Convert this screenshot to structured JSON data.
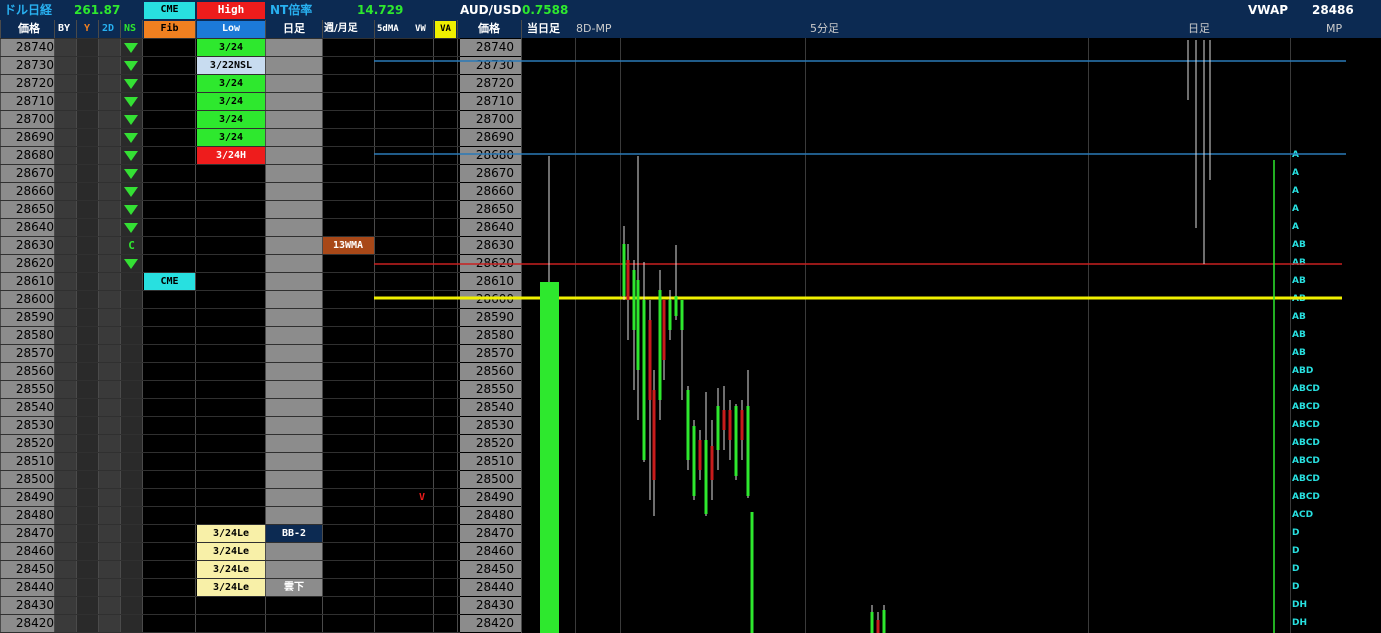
{
  "header": {
    "nikkei_label": "ドル日経",
    "nikkei_value": "261.87",
    "cme": "CME",
    "high": "High",
    "nt_label": "NT倍率",
    "nt_value": "14.729",
    "aud_label": "AUD/USD",
    "aud_value": "0.7588",
    "vwap_label": "VWAP",
    "vwap_value": "28486"
  },
  "subheader": {
    "price": "価格",
    "by": "BY",
    "y": "Y",
    "d2": "2D",
    "ns": "NS",
    "fib": "Fib",
    "low": "Low",
    "daily": "日足",
    "weekly_monthly": "週/月足",
    "ma5": "5dMA",
    "vw": "VW",
    "va": "VA",
    "price2": "価格",
    "today": "当日足",
    "mp8d": "8D-MP",
    "min5": "5分足",
    "daily2": "日足",
    "mp": "MP"
  },
  "prices": [
    "28740",
    "28730",
    "28720",
    "28710",
    "28700",
    "28690",
    "28680",
    "28670",
    "28660",
    "28650",
    "28640",
    "28630",
    "28620",
    "28610",
    "28600",
    "28590",
    "28580",
    "28570",
    "28560",
    "28550",
    "28540",
    "28530",
    "28520",
    "28510",
    "28500",
    "28490",
    "28480",
    "28470",
    "28460",
    "28450",
    "28440",
    "28430",
    "28420"
  ],
  "ns_marks": [
    "▼",
    "▼",
    "▼",
    "▼",
    "▼",
    "▼",
    "▼",
    "▼",
    "▼",
    "▼",
    "▼",
    "C",
    "▼"
  ],
  "fib_labels": [
    {
      "row": 13,
      "text": "CME"
    }
  ],
  "high_low_labels": [
    {
      "row": 0,
      "text": "3/24",
      "color": "#2ee82e"
    },
    {
      "row": 1,
      "text": "3/22NSL",
      "color": "#c8dcf0"
    },
    {
      "row": 2,
      "text": "3/24",
      "color": "#2ee82e"
    },
    {
      "row": 3,
      "text": "3/24",
      "color": "#2ee82e"
    },
    {
      "row": 4,
      "text": "3/24",
      "color": "#2ee82e"
    },
    {
      "row": 5,
      "text": "3/24",
      "color": "#2ee82e"
    },
    {
      "row": 6,
      "text": "3/24H",
      "color": "#ee1c1c"
    },
    {
      "row": 27,
      "text": "3/24Le",
      "color": "#f8f0a8"
    },
    {
      "row": 28,
      "text": "3/24Le",
      "color": "#f8f0a8"
    },
    {
      "row": 29,
      "text": "3/24Le",
      "color": "#f8f0a8"
    },
    {
      "row": 30,
      "text": "3/24Le",
      "color": "#f8f0a8"
    }
  ],
  "daily_labels": [
    {
      "row": 27,
      "text": "BB-2"
    },
    {
      "row": 30,
      "text": "雲下"
    }
  ],
  "weekly_labels": [
    {
      "row": 11,
      "text": "13WMA"
    }
  ],
  "vw_labels": [
    {
      "row": 25,
      "text": "V"
    }
  ],
  "mp_letters": [
    "",
    "",
    "",
    "",
    "",
    "",
    "A",
    "A",
    "A",
    "A",
    "A",
    "AB",
    "AB",
    "AB",
    "AB",
    "AB",
    "AB",
    "AB",
    "ABD",
    "ABCD",
    "ABCD",
    "ABCD",
    "ABCD",
    "ABCD",
    "ABCD",
    "ABCD",
    "ACD",
    "D",
    "D",
    "D",
    "D",
    "DH",
    "DH"
  ],
  "colors": {
    "header_bg": "#0c2a52",
    "green": "#2ee82e",
    "red": "#ee1c1c",
    "cyan": "#28e0e0",
    "yellow": "#f0f000",
    "gray": "#8c8c8c"
  }
}
